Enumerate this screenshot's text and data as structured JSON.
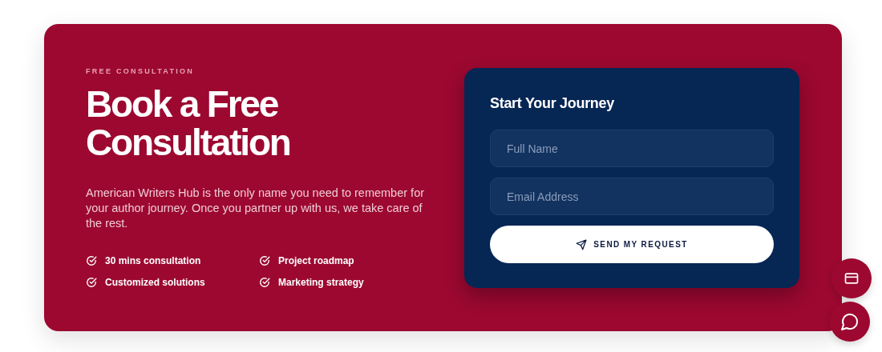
{
  "eyebrow": "FREE CONSULTATION",
  "headline": [
    "Book a Free",
    "Consultation"
  ],
  "description": "American Writers Hub is the only name you need to remember for your author journey. Once you partner up with us, we take care of the rest.",
  "features": [
    {
      "label": "30 mins consultation"
    },
    {
      "label": "Project roadmap"
    },
    {
      "label": "Customized solutions"
    },
    {
      "label": "Marketing strategy"
    }
  ],
  "form": {
    "title": "Start Your Journey",
    "fields": [
      {
        "placeholder": "Full Name"
      },
      {
        "placeholder": "Email Address"
      }
    ],
    "submit": "SEND MY REQUEST"
  }
}
